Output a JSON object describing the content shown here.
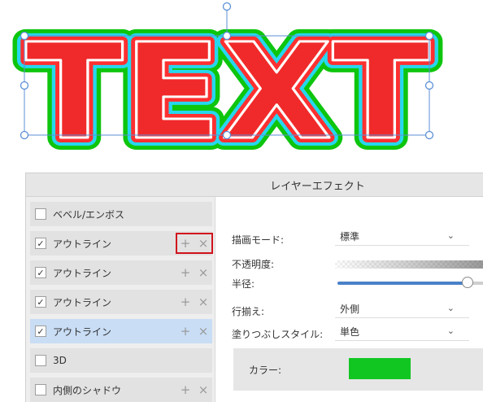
{
  "canvas": {
    "text": "TEXT",
    "fill_color": "#f02a2a",
    "outline_colors": [
      "#ffffff",
      "#ff3030",
      "#27d7ef",
      "#0ec50e"
    ]
  },
  "panel": {
    "title": "レイヤーエフェクト",
    "effects": [
      {
        "label": "ベベル/エンボス",
        "checked": false,
        "selected": false,
        "show_actions": false
      },
      {
        "label": "アウトライン",
        "checked": true,
        "selected": false,
        "show_actions": true,
        "highlighted": true
      },
      {
        "label": "アウトライン",
        "checked": true,
        "selected": false,
        "show_actions": true
      },
      {
        "label": "アウトライン",
        "checked": true,
        "selected": false,
        "show_actions": true
      },
      {
        "label": "アウトライン",
        "checked": true,
        "selected": true,
        "show_actions": true
      },
      {
        "label": "3D",
        "checked": false,
        "selected": false,
        "show_actions": false
      },
      {
        "label": "内側のシャドウ",
        "checked": false,
        "selected": false,
        "show_actions": true
      }
    ],
    "actions": {
      "add": "+",
      "remove": "×"
    },
    "settings": {
      "blend_mode_label": "描画モード:",
      "blend_mode_value": "標準",
      "opacity_label": "不透明度:",
      "radius_label": "半径:",
      "radius_fraction": 0.94,
      "alignment_label": "行揃え:",
      "alignment_value": "外側",
      "fill_style_label": "塗りつぶしスタイル:",
      "fill_style_value": "単色",
      "color_label": "カラー:",
      "color_value": "#12c622"
    }
  }
}
